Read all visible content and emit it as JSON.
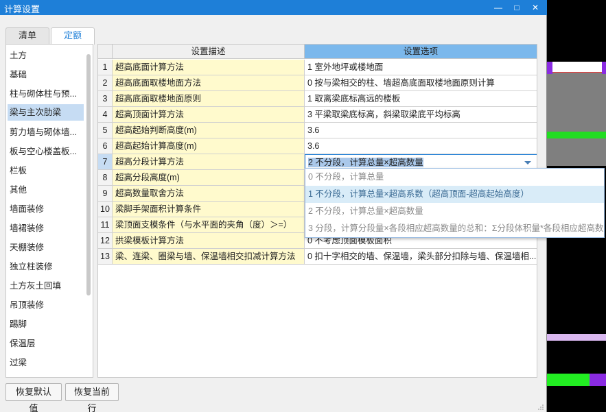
{
  "window": {
    "title": "计算设置",
    "minimize": "—",
    "maximize": "□",
    "close": "✕"
  },
  "tabs": [
    {
      "label": "清单"
    },
    {
      "label": "定额"
    }
  ],
  "sidebar": {
    "items": [
      {
        "label": "土方"
      },
      {
        "label": "基础"
      },
      {
        "label": "柱与砌体柱与预..."
      },
      {
        "label": "梁与主次肋梁"
      },
      {
        "label": "剪力墙与砌体墙..."
      },
      {
        "label": "板与空心楼盖板..."
      },
      {
        "label": "栏板"
      },
      {
        "label": "其他"
      },
      {
        "label": "墙面装修"
      },
      {
        "label": "墙裙装修"
      },
      {
        "label": "天棚装修"
      },
      {
        "label": "独立柱装修"
      },
      {
        "label": "土方灰土回填"
      },
      {
        "label": "吊顶装修"
      },
      {
        "label": "踢脚"
      },
      {
        "label": "保温层"
      },
      {
        "label": "过梁"
      }
    ]
  },
  "table": {
    "headers": {
      "desc": "设置描述",
      "value": "设置选项"
    },
    "rows": [
      {
        "num": "1",
        "desc": "超高底面计算方法",
        "value": "1 室外地坪或楼地面"
      },
      {
        "num": "2",
        "desc": "超高底面取楼地面方法",
        "value": "0 按与梁相交的柱、墙超高底面取楼地面原则计算"
      },
      {
        "num": "3",
        "desc": "超高底面取楼地面原则",
        "value": "1 取离梁底标高远的楼板"
      },
      {
        "num": "4",
        "desc": "超高顶面计算方法",
        "value": "3 平梁取梁底标高，斜梁取梁底平均标高"
      },
      {
        "num": "5",
        "desc": "超高起始判断高度(m)",
        "value": "3.6"
      },
      {
        "num": "6",
        "desc": "超高起始计算高度(m)",
        "value": "3.6"
      },
      {
        "num": "7",
        "desc": "超高分段计算方法",
        "value": "2 不分段，计算总量×超高数量"
      },
      {
        "num": "8",
        "desc": "超高分段高度(m)",
        "value": ""
      },
      {
        "num": "9",
        "desc": "超高数量取舍方法",
        "value": ""
      },
      {
        "num": "10",
        "desc": "梁脚手架面积计算条件",
        "value": ""
      },
      {
        "num": "11",
        "desc": "梁顶面支模条件（与水平面的夹角（度）＞=）",
        "value": ""
      },
      {
        "num": "12",
        "desc": "拱梁模板计算方法",
        "value": "0 不考虑顶面模板面积"
      },
      {
        "num": "13",
        "desc": "梁、连梁、圈梁与墙、保温墙相交扣减计算方法",
        "value": "0 扣十字相交的墙、保温墙，梁头部分扣除与墙、保温墙相..."
      }
    ]
  },
  "dropdown": {
    "options": [
      {
        "label": "0 不分段，计算总量"
      },
      {
        "label": "1 不分段，计算总量×超高系数（超高顶面-超高起始高度）"
      },
      {
        "label": "2 不分段，计算总量×超高数量"
      },
      {
        "label": "3 分段，计算分段量×各段相应超高数量的总和：Σ分段体积量*各段相应超高数量"
      }
    ]
  },
  "buttons": {
    "restore_default": "恢复默认值",
    "restore_current": "恢复当前行"
  },
  "colors": {
    "title_bar": "#1e7fd8",
    "desc_cell": "#fffacd",
    "selection": "#c6dcf3",
    "header_active": "#7bb8ec"
  }
}
